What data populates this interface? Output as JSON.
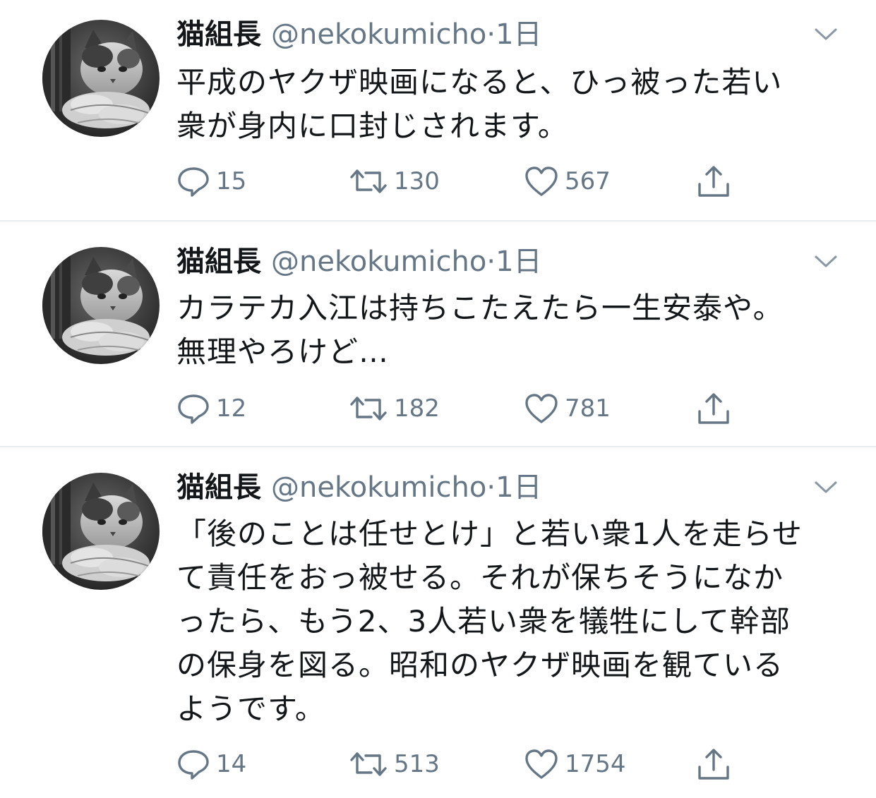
{
  "tweets": [
    {
      "display_name": "猫組長",
      "handle": "@nekokumicho",
      "separator": "·",
      "time": "1日",
      "avatar_icon": "cat-avatar",
      "lines": [
        "平成のヤクザ映画になると、ひっ被った若い",
        "衆が身内に口封じされます。"
      ],
      "reply_count": "15",
      "retweet_count": "130",
      "like_count": "567"
    },
    {
      "display_name": "猫組長",
      "handle": "@nekokumicho",
      "separator": "·",
      "time": "1日",
      "avatar_icon": "cat-avatar",
      "lines": [
        "カラテカ入江は持ちこたえたら一生安泰や。",
        "無理やろけど…"
      ],
      "reply_count": "12",
      "retweet_count": "182",
      "like_count": "781"
    },
    {
      "display_name": "猫組長",
      "handle": "@nekokumicho",
      "separator": "·",
      "time": "1日",
      "avatar_icon": "cat-avatar",
      "lines": [
        "「後のことは任せとけ」と若い衆1人を走らせ",
        "て責任をおっ被せる。それが保ちそうになか",
        "ったら、もう2、3人若い衆を犠牲にして幹部",
        "の保身を図る。昭和のヤクザ映画を観ている",
        "ようです。"
      ],
      "reply_count": "14",
      "retweet_count": "513",
      "like_count": "1754"
    }
  ],
  "icons": {
    "reply": "reply-icon",
    "retweet": "retweet-icon",
    "like": "heart-icon",
    "share": "share-icon",
    "menu": "chevron-down-icon"
  },
  "colors": {
    "text": "#14171a",
    "secondary": "#657786",
    "divider": "#e6ecf0",
    "background": "#ffffff"
  }
}
